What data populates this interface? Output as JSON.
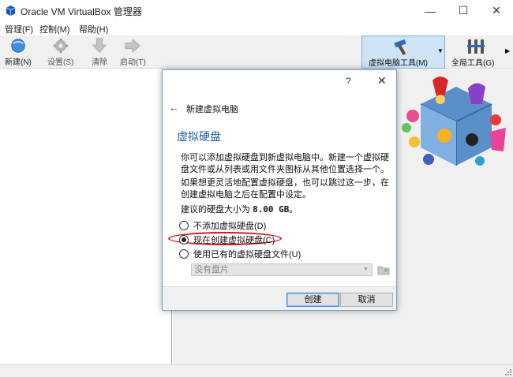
{
  "window": {
    "title": "Oracle VM VirtualBox 管理器",
    "minimize_glyph": "—",
    "maximize_glyph": "☐",
    "close_glyph": "✕"
  },
  "menu": [
    "管理(F)",
    "控制(M)",
    "帮助(H)"
  ],
  "toolbar": {
    "new_label": "新建(N)",
    "settings_label": "设置(S)",
    "discard_label": "清除",
    "start_label": "启动(T)"
  },
  "tools": {
    "machine_tools_label": "虚拟电脑工具(M)",
    "global_tools_label": "全局工具(G)"
  },
  "dialog": {
    "help_glyph": "?",
    "close_glyph": "✕",
    "back_glyph": "←",
    "header": "新建虚拟电脑",
    "section_title": "虚拟硬盘",
    "para1": "你可以添加虚拟硬盘到新虚拟电脑中。新建一个虚拟硬盘文件或从列表或用文件夹图标从其他位置选择一个。",
    "para2": "如果想更灵活地配置虚拟硬盘，也可以跳过这一步，在创建虚拟电脑之后在配置中设定。",
    "recommend_prefix": "建议的硬盘大小为 ",
    "recommend_size": "8.00 GB",
    "recommend_suffix": "。",
    "options": [
      {
        "label": "不添加虚拟硬盘(D)",
        "checked": false
      },
      {
        "label": "现在创建虚拟硬盘(C)",
        "checked": true
      },
      {
        "label": "使用已有的虚拟硬盘文件(U)",
        "checked": false
      }
    ],
    "combo_value": "没有盘片",
    "create_button": "创建",
    "cancel_button": "取消"
  },
  "colors": {
    "accent": "#1a5aa8",
    "highlight_ellipse": "#d01818",
    "tool_selected": "#cfe3f5"
  }
}
